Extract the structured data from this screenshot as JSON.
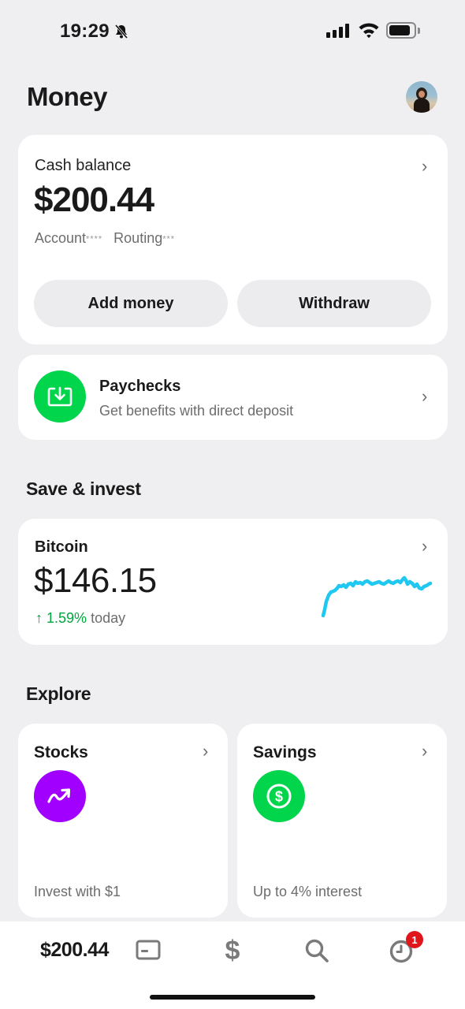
{
  "status_bar": {
    "time": "19:29"
  },
  "header": {
    "title": "Money"
  },
  "cash": {
    "label": "Cash balance",
    "amount": "$200.44",
    "account_label": "Account",
    "account_mask": "****",
    "routing_label": "Routing",
    "routing_mask": "***",
    "add_money_label": "Add money",
    "withdraw_label": "Withdraw"
  },
  "paychecks": {
    "title": "Paychecks",
    "subtitle": "Get benefits with direct deposit"
  },
  "sections": {
    "save_invest": "Save & invest",
    "explore": "Explore"
  },
  "bitcoin": {
    "title": "Bitcoin",
    "amount": "$146.15",
    "change_arrow": "↑",
    "change_pct": "1.59%",
    "change_suffix": "today",
    "chart_color": "#1ec8f0"
  },
  "explore": {
    "stocks": {
      "title": "Stocks",
      "subtitle": "Invest with $1",
      "icon": "trend-up-icon",
      "color": "#a100ff"
    },
    "savings": {
      "title": "Savings",
      "subtitle": "Up to 4% interest",
      "icon": "dollar-circle-icon",
      "color": "#00d54b"
    }
  },
  "tab_bar": {
    "balance": "$200.44",
    "activity_badge": "1",
    "tabs": [
      "card-icon",
      "dollar-icon",
      "search-icon",
      "clock-icon"
    ]
  },
  "colors": {
    "accent_green": "#00d54b",
    "positive_green": "#00a63e",
    "badge_red": "#e0161d"
  }
}
